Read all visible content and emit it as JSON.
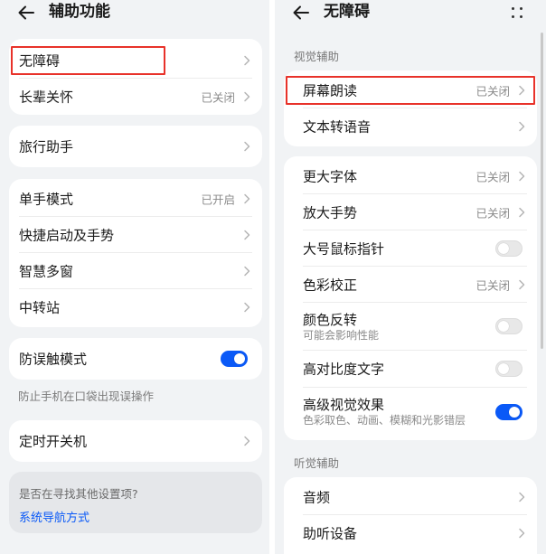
{
  "left": {
    "title": "辅助功能",
    "groups": {
      "g1": [
        {
          "label": "无障碍",
          "value": ""
        },
        {
          "label": "长辈关怀",
          "value": "已关闭"
        }
      ],
      "g2": [
        {
          "label": "旅行助手",
          "value": ""
        }
      ],
      "g3": [
        {
          "label": "单手模式",
          "value": "已开启"
        },
        {
          "label": "快捷启动及手势",
          "value": ""
        },
        {
          "label": "智慧多窗",
          "value": ""
        },
        {
          "label": "中转站",
          "value": ""
        }
      ],
      "g4": [
        {
          "label": "防误触模式",
          "toggle": true
        }
      ],
      "g5": [
        {
          "label": "定时开关机",
          "value": ""
        }
      ]
    },
    "anti_mistouch_note": "防止手机在口袋出现误操作",
    "hint": {
      "question": "是否在寻找其他设置项?",
      "link": "系统导航方式"
    }
  },
  "right": {
    "title": "无障碍",
    "sections": {
      "visual": "视觉辅助",
      "hearing": "听觉辅助"
    },
    "groups": {
      "v1": [
        {
          "label": "屏幕朗读",
          "value": "已关闭"
        },
        {
          "label": "文本转语音",
          "value": ""
        }
      ],
      "v2": [
        {
          "label": "更大字体",
          "value": "已关闭"
        },
        {
          "label": "放大手势",
          "value": "已关闭"
        },
        {
          "label": "大号鼠标指针",
          "toggle": false
        },
        {
          "label": "色彩校正",
          "value": "已关闭"
        },
        {
          "label": "颜色反转",
          "sub": "可能会影响性能",
          "toggle": false
        },
        {
          "label": "高对比度文字",
          "toggle": false
        },
        {
          "label": "高级视觉效果",
          "sub": "色彩取色、动画、模糊和光影错层",
          "toggle": true
        }
      ],
      "h1": [
        {
          "label": "音频",
          "value": ""
        },
        {
          "label": "助听设备",
          "value": ""
        }
      ]
    }
  },
  "colors": {
    "accent": "#0a59f7",
    "highlight": "#e8322a",
    "background": "#f1f3f5"
  }
}
